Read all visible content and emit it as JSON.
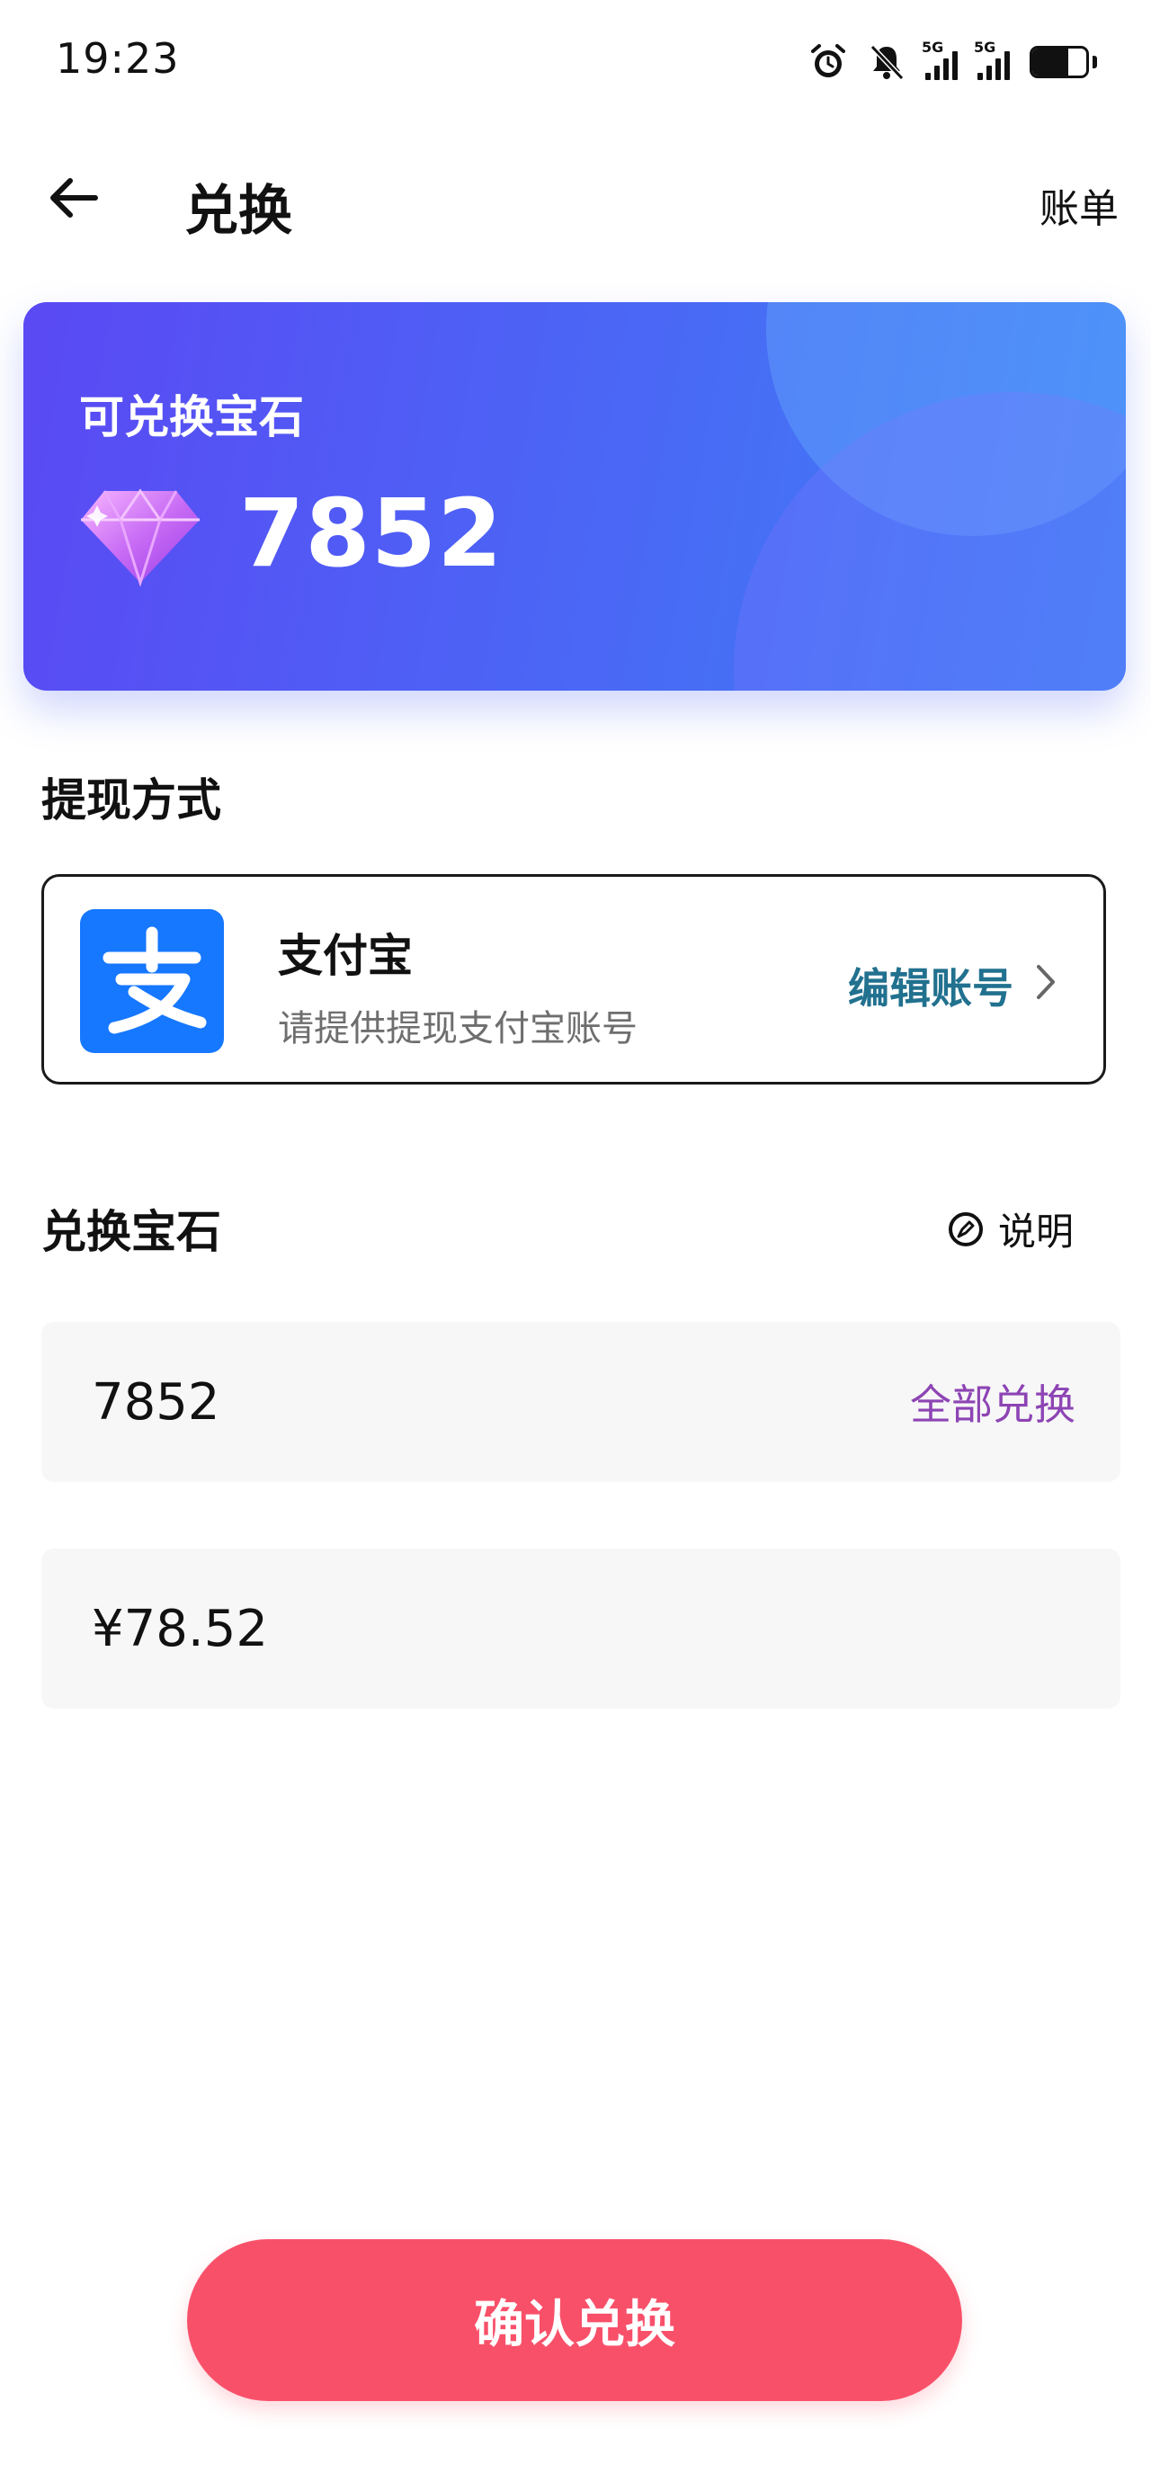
{
  "status_bar": {
    "time": "19:23",
    "network_label_1": "5G",
    "network_label_2": "5G",
    "icons": [
      "alarm-icon",
      "mute-bell-icon",
      "signal-5g-icon",
      "signal-5g-icon",
      "battery-icon"
    ],
    "battery_level": 0.66
  },
  "header": {
    "back_icon": "arrow-left-icon",
    "title": "兑换",
    "bill_link": "账单"
  },
  "gem_card": {
    "label": "可兑换宝石",
    "value": "7852",
    "icon": "diamond-icon",
    "gradient_colors": [
      "#5a49f4",
      "#3c82f6"
    ]
  },
  "withdraw_method": {
    "section_title": "提现方式",
    "method_icon": "alipay-icon",
    "method_name": "支付宝",
    "method_desc": "请提供提现支付宝账号",
    "edit_label": "编辑账号",
    "chevron_icon": "chevron-right-icon"
  },
  "exchange": {
    "section_title": "兑换宝石",
    "explain_icon": "help-pin-icon",
    "explain_label": "说明",
    "gem_input_value": "7852",
    "all_exchange_label": "全部兑换",
    "money_value": "¥78.52"
  },
  "confirm_button": {
    "label": "确认兑换",
    "color": "#f9506a"
  },
  "colors": {
    "edit_link": "#21718f",
    "all_exchange_link": "#8d44b4",
    "alipay_blue": "#1677ff"
  }
}
